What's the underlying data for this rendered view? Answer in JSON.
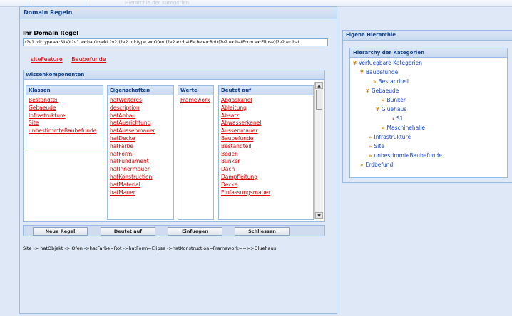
{
  "window": {
    "title": "Domain Regeln"
  },
  "top_ghost": "Hierarchie der Kategorien",
  "rule": {
    "label": "Ihr Domain Regel",
    "value": "(?v1 rdf:type ex:Site)(?v1 ex:hatObjekt ?v2)(?v2 rdf:type ex:Ofen)(?v2 ex:hatFarbe ex:Rot)(?v2 ex:hatForm ex:Elipse)(?v2 ex:hat"
  },
  "links": [
    "siteFeature",
    "Baubefunde"
  ],
  "wissen": {
    "title": "Wissenkomponenten",
    "columns": [
      {
        "header": "Klassen",
        "items": [
          "Bestandteil",
          "Gebaeude",
          "Infrastrukture",
          "Site",
          "unbestimmteBaubefunde"
        ]
      },
      {
        "header": "Eigenschaften",
        "items": [
          "hatWeiteres",
          "description",
          "hatAnbau",
          "hatAusrichtung",
          "hatAussenmauer",
          "hatDecke",
          "hatFarbe",
          "hatForm",
          "hatFundament",
          "hatInnermauer",
          "hatKonstruction",
          "hatMaterial",
          "hatMauer"
        ]
      },
      {
        "header": "Werte",
        "items": [
          "Framework"
        ]
      },
      {
        "header": "Deutet auf",
        "items": [
          "Abgaskanel",
          "Ableitung",
          "Absatz",
          "Abwasserkanel",
          "Aussenmauer",
          "Baubefunde",
          "Bestandteil",
          "Boden",
          "Bunker",
          "Dach",
          "Dampfleitung",
          "Decke",
          "Einfassungsmauer"
        ]
      }
    ]
  },
  "buttons": {
    "neue_regel": "Neue Regel",
    "deutet_auf": "Deutet auf",
    "einfuegen": "Einfuegen",
    "schliessen": "Schliessen"
  },
  "result_text": "Site -> hatObjekt -> Ofen ->hatFarbe=Rot ->hatForm=Elipse ->hatKonstruction=Framework==>>Gluehaus",
  "hierarchy": {
    "title": "Eigene Hierarchie",
    "tree_title": "Hierarchy der Kategorien",
    "nodes": [
      "Verfuegbare Kategorien",
      "Baubefunde",
      "Bestandteil",
      "Gebaeude",
      "Bunker",
      "Gluehaus",
      "S1",
      "Maschinehalle",
      "Infrastrukture",
      "Site",
      "unbestimmteBaubefunde",
      "Erdbefund"
    ]
  }
}
